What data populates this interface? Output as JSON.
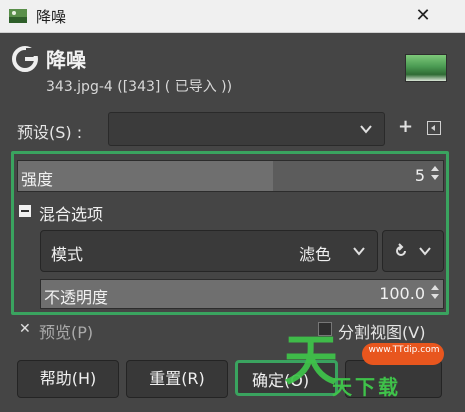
{
  "window": {
    "title": "降噪",
    "close_glyph": "✕"
  },
  "header": {
    "title": "降噪",
    "subtitle": "343.jpg-4 ([343] ( 已导入 ))"
  },
  "presets": {
    "label": "预设(S) :",
    "value": "",
    "add_glyph": "+"
  },
  "strength": {
    "label": "强度",
    "value": "5",
    "fill_fraction": 0.6
  },
  "blending": {
    "title": "混合选项",
    "mode_label": "模式",
    "mode_value": "滤色",
    "opacity_label": "不透明度",
    "opacity_value": "100.0",
    "opacity_fill_fraction": 1.0
  },
  "preview": {
    "label": "预览(P)",
    "checked": true,
    "check_glyph": "✕"
  },
  "split_view": {
    "label": "分割视图(V)",
    "checked": false
  },
  "buttons": {
    "help": "帮助(H)",
    "reset": "重置(R)",
    "ok": "确定(O)",
    "cancel": ""
  },
  "watermark": {
    "url": "www.TTdip.com",
    "big_char": "天",
    "text": "天下载"
  },
  "colors": {
    "highlight": "#3aa35f",
    "watermark_green": "#3fc24a",
    "watermark_orange": "#e8561e"
  }
}
